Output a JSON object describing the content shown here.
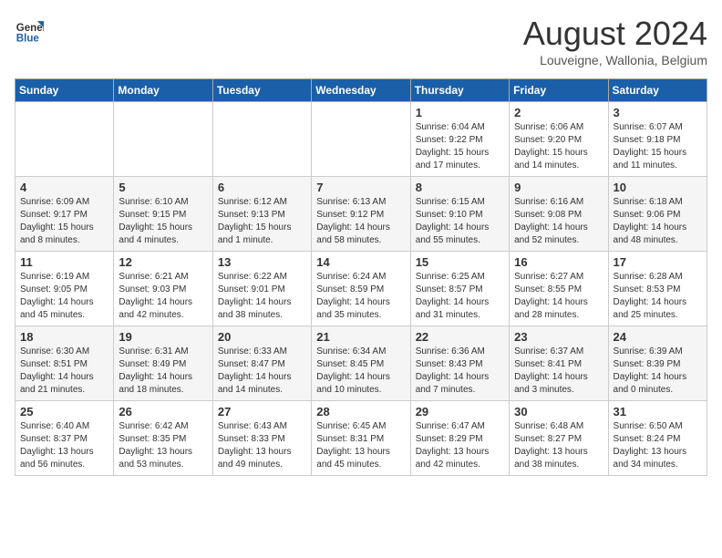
{
  "header": {
    "logo": {
      "general": "General",
      "blue": "Blue"
    },
    "title": "August 2024",
    "location": "Louveigne, Wallonia, Belgium"
  },
  "calendar": {
    "days_of_week": [
      "Sunday",
      "Monday",
      "Tuesday",
      "Wednesday",
      "Thursday",
      "Friday",
      "Saturday"
    ],
    "weeks": [
      [
        {
          "day": "",
          "info": ""
        },
        {
          "day": "",
          "info": ""
        },
        {
          "day": "",
          "info": ""
        },
        {
          "day": "",
          "info": ""
        },
        {
          "day": "1",
          "info": "Sunrise: 6:04 AM\nSunset: 9:22 PM\nDaylight: 15 hours and 17 minutes."
        },
        {
          "day": "2",
          "info": "Sunrise: 6:06 AM\nSunset: 9:20 PM\nDaylight: 15 hours and 14 minutes."
        },
        {
          "day": "3",
          "info": "Sunrise: 6:07 AM\nSunset: 9:18 PM\nDaylight: 15 hours and 11 minutes."
        }
      ],
      [
        {
          "day": "4",
          "info": "Sunrise: 6:09 AM\nSunset: 9:17 PM\nDaylight: 15 hours and 8 minutes."
        },
        {
          "day": "5",
          "info": "Sunrise: 6:10 AM\nSunset: 9:15 PM\nDaylight: 15 hours and 4 minutes."
        },
        {
          "day": "6",
          "info": "Sunrise: 6:12 AM\nSunset: 9:13 PM\nDaylight: 15 hours and 1 minute."
        },
        {
          "day": "7",
          "info": "Sunrise: 6:13 AM\nSunset: 9:12 PM\nDaylight: 14 hours and 58 minutes."
        },
        {
          "day": "8",
          "info": "Sunrise: 6:15 AM\nSunset: 9:10 PM\nDaylight: 14 hours and 55 minutes."
        },
        {
          "day": "9",
          "info": "Sunrise: 6:16 AM\nSunset: 9:08 PM\nDaylight: 14 hours and 52 minutes."
        },
        {
          "day": "10",
          "info": "Sunrise: 6:18 AM\nSunset: 9:06 PM\nDaylight: 14 hours and 48 minutes."
        }
      ],
      [
        {
          "day": "11",
          "info": "Sunrise: 6:19 AM\nSunset: 9:05 PM\nDaylight: 14 hours and 45 minutes."
        },
        {
          "day": "12",
          "info": "Sunrise: 6:21 AM\nSunset: 9:03 PM\nDaylight: 14 hours and 42 minutes."
        },
        {
          "day": "13",
          "info": "Sunrise: 6:22 AM\nSunset: 9:01 PM\nDaylight: 14 hours and 38 minutes."
        },
        {
          "day": "14",
          "info": "Sunrise: 6:24 AM\nSunset: 8:59 PM\nDaylight: 14 hours and 35 minutes."
        },
        {
          "day": "15",
          "info": "Sunrise: 6:25 AM\nSunset: 8:57 PM\nDaylight: 14 hours and 31 minutes."
        },
        {
          "day": "16",
          "info": "Sunrise: 6:27 AM\nSunset: 8:55 PM\nDaylight: 14 hours and 28 minutes."
        },
        {
          "day": "17",
          "info": "Sunrise: 6:28 AM\nSunset: 8:53 PM\nDaylight: 14 hours and 25 minutes."
        }
      ],
      [
        {
          "day": "18",
          "info": "Sunrise: 6:30 AM\nSunset: 8:51 PM\nDaylight: 14 hours and 21 minutes."
        },
        {
          "day": "19",
          "info": "Sunrise: 6:31 AM\nSunset: 8:49 PM\nDaylight: 14 hours and 18 minutes."
        },
        {
          "day": "20",
          "info": "Sunrise: 6:33 AM\nSunset: 8:47 PM\nDaylight: 14 hours and 14 minutes."
        },
        {
          "day": "21",
          "info": "Sunrise: 6:34 AM\nSunset: 8:45 PM\nDaylight: 14 hours and 10 minutes."
        },
        {
          "day": "22",
          "info": "Sunrise: 6:36 AM\nSunset: 8:43 PM\nDaylight: 14 hours and 7 minutes."
        },
        {
          "day": "23",
          "info": "Sunrise: 6:37 AM\nSunset: 8:41 PM\nDaylight: 14 hours and 3 minutes."
        },
        {
          "day": "24",
          "info": "Sunrise: 6:39 AM\nSunset: 8:39 PM\nDaylight: 14 hours and 0 minutes."
        }
      ],
      [
        {
          "day": "25",
          "info": "Sunrise: 6:40 AM\nSunset: 8:37 PM\nDaylight: 13 hours and 56 minutes."
        },
        {
          "day": "26",
          "info": "Sunrise: 6:42 AM\nSunset: 8:35 PM\nDaylight: 13 hours and 53 minutes."
        },
        {
          "day": "27",
          "info": "Sunrise: 6:43 AM\nSunset: 8:33 PM\nDaylight: 13 hours and 49 minutes."
        },
        {
          "day": "28",
          "info": "Sunrise: 6:45 AM\nSunset: 8:31 PM\nDaylight: 13 hours and 45 minutes."
        },
        {
          "day": "29",
          "info": "Sunrise: 6:47 AM\nSunset: 8:29 PM\nDaylight: 13 hours and 42 minutes."
        },
        {
          "day": "30",
          "info": "Sunrise: 6:48 AM\nSunset: 8:27 PM\nDaylight: 13 hours and 38 minutes."
        },
        {
          "day": "31",
          "info": "Sunrise: 6:50 AM\nSunset: 8:24 PM\nDaylight: 13 hours and 34 minutes."
        }
      ]
    ]
  }
}
